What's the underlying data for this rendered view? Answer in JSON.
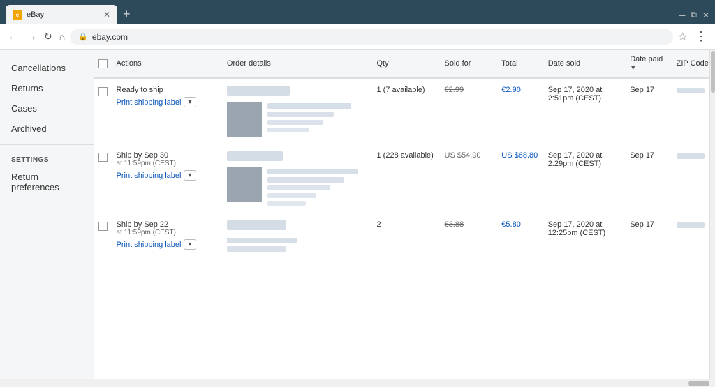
{
  "browser": {
    "tab_title": "eBay",
    "url": "ebay.com",
    "new_tab_label": "+",
    "menu_dots": "⋮"
  },
  "sidebar": {
    "items": [
      {
        "id": "cancellations",
        "label": "Cancellations"
      },
      {
        "id": "returns",
        "label": "Returns"
      },
      {
        "id": "cases",
        "label": "Cases"
      },
      {
        "id": "archived",
        "label": "Archived"
      }
    ],
    "settings_title": "SETTINGS",
    "settings_items": [
      {
        "id": "return-preferences",
        "label": "Return preferences"
      }
    ]
  },
  "table": {
    "headers": {
      "actions": "Actions",
      "order_details": "Order details",
      "qty": "Qty",
      "sold_for": "Sold for",
      "total": "Total",
      "date_sold": "Date sold",
      "date_paid": "Date paid",
      "zip_code": "ZIP Code"
    },
    "orders": [
      {
        "id": "order-1",
        "action_label": "Ready to ship",
        "print_label": "Print shipping label",
        "qty": "1 (7 available)",
        "price_crossed": "€2.99",
        "price_blue": "€2.90",
        "date_sold": "Sep 17, 2020 at 2:51pm (CEST)",
        "date_paid": "Sep 17"
      },
      {
        "id": "order-2",
        "action_label": "Ship by Sep 30",
        "action_sub": "at 11:59pm (CEST)",
        "print_label": "Print shipping label",
        "qty": "1 (228 available)",
        "price_crossed": "US $54.90",
        "price_blue": "US $68.80",
        "date_sold": "Sep 17, 2020 at 2:29pm (CEST)",
        "date_paid": "Sep 17"
      },
      {
        "id": "order-3",
        "action_label": "Ship by Sep 22",
        "action_sub": "at 11:59pm (CEST)",
        "print_label": "Print shipping label",
        "qty": "2",
        "price_crossed": "€3.88",
        "price_blue": "€5.80",
        "date_sold": "Sep 17, 2020 at 12:25pm (CEST)",
        "date_paid": "Sep 17"
      }
    ]
  }
}
